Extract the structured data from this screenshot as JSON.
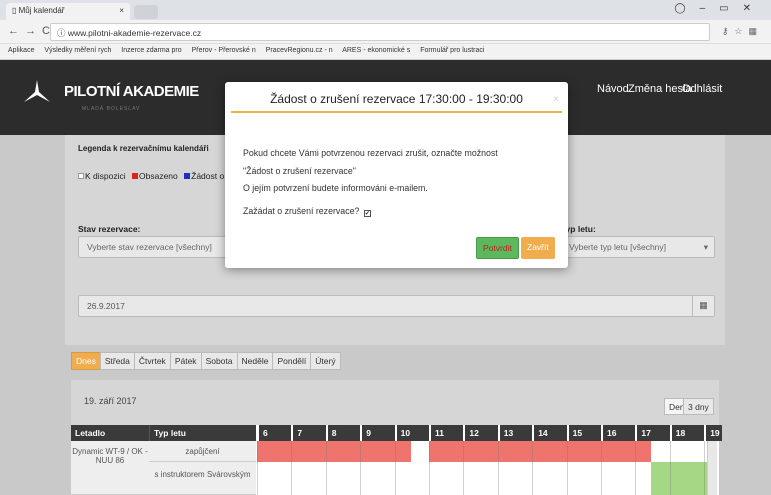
{
  "browser": {
    "tab_title": "Můj kalendář",
    "url": "www.pilotni-akademie-rezervace.cz",
    "bookmarks": [
      "Aplikace",
      "Výsledky měření rych",
      "Inzerce zdarma pro",
      "Přerov - Přerovské n",
      "PracevRegionu.cz - n",
      "ARES - ekonomické s",
      "Formulář pro lustraci"
    ]
  },
  "header": {
    "brand": "PILOTNÍ AKADEMIE",
    "brand_sub": "MLADÁ BOLESLAV",
    "nav": {
      "navod": "Návod",
      "zmena": "Změna hesla",
      "odhlasit": "Odhlásit"
    }
  },
  "legend": {
    "title": "Legenda k rezervačnímu kalendáři",
    "items": [
      {
        "label": "K dispozici",
        "color": "#ffffff"
      },
      {
        "label": "Obsazeno",
        "color": "#e02020"
      },
      {
        "label": "Žádost o",
        "color": "#2030c0"
      }
    ]
  },
  "filters": {
    "stav_label": "Stav rezervace:",
    "stav_value": "Vyberte stav rezervace [všechny]",
    "typ_label": "Typ letu:",
    "typ_value": "Vyberte typ letu [všechny]",
    "date": "26.9.2017"
  },
  "days": [
    "Dnes",
    "Středa",
    "Čtvrtek",
    "Pátek",
    "Sobota",
    "Neděle",
    "Pondělí",
    "Úterý"
  ],
  "calendar": {
    "date_label": "19. září 2017",
    "view_day": "Den",
    "view_3days": "3 dny",
    "col_letadlo": "Letadlo",
    "col_typ": "Typ letu",
    "hours": [
      "6",
      "7",
      "8",
      "9",
      "10",
      "11",
      "12",
      "13",
      "14",
      "15",
      "16",
      "17",
      "18",
      "19"
    ],
    "aircraft": "Dynamic WT-9 / OK - NUU 86",
    "row1_type": "zapůjčení",
    "row2_type": "s instruktorem Svárovským"
  },
  "modal": {
    "title": "Žádost o zrušení rezervace 17:30:00 - 19:30:00",
    "close": "×",
    "line1": "Pokud chcete Vámi potvrzenou rezervaci zrušit, označte možnost",
    "line2": "\"Žádost o zrušení rezervace\"",
    "line3": "O jejím potvrzení budete informováni e-mailem.",
    "checkbox_label": "Zažádat o zrušení rezervace?",
    "confirm": "Potvrdit",
    "close_button": "Zavřít",
    "colors": {
      "accent": "#f0ad4e",
      "success": "#5cb85c"
    }
  }
}
